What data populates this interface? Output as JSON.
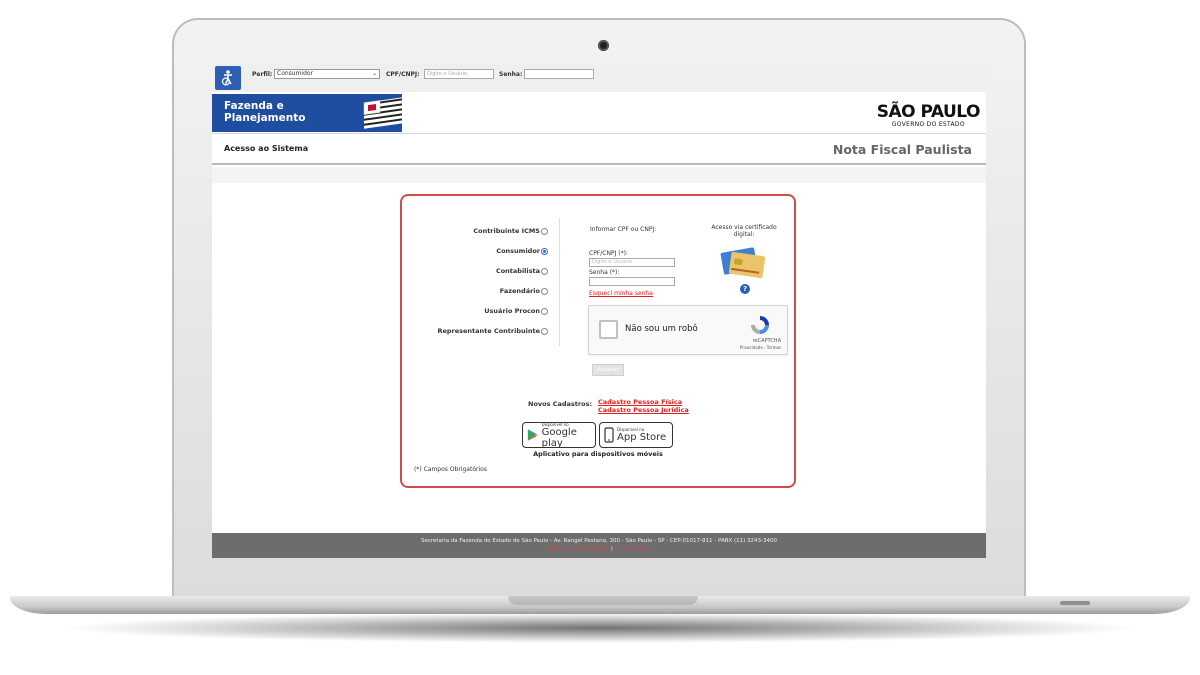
{
  "topbar": {
    "perfil_label": "Perfil:",
    "perfil_value": "Consumidor",
    "cpf_label": "CPF/CNPJ:",
    "cpf_placeholder": "Digite o Usuário",
    "senha_label": "Senha:",
    "senha_value": ""
  },
  "banner": {
    "brand_line1": "Fazenda e",
    "brand_line2": "Planejamento",
    "sp_logo_big": "SÃO PAULO",
    "sp_logo_small": "GOVERNO DO ESTADO"
  },
  "titlebar": {
    "left": "Acesso ao Sistema",
    "right": "Nota Fiscal Paulista"
  },
  "login": {
    "profiles": [
      {
        "label": "Contribuinte ICMS",
        "selected": false
      },
      {
        "label": "Consumidor",
        "selected": true
      },
      {
        "label": "Contabilista",
        "selected": false
      },
      {
        "label": "Fazendário",
        "selected": false
      },
      {
        "label": "Usuário Procon",
        "selected": false
      },
      {
        "label": "Representante Contribuinte",
        "selected": false
      }
    ],
    "cpf_hint": "Informar CPF ou CNPJ:",
    "cpf_field_label": "CPF/CNPJ (*):",
    "cpf_field_placeholder": "Digite o Usuário",
    "senha_field_label": "Senha (*):",
    "forgot_link": "Esqueci minha senha",
    "cert_text": "Acesso via certificado digital:",
    "captcha": {
      "text": "Não sou um robô",
      "brand": "reCAPTCHA",
      "terms": "Privacidade - Termos"
    },
    "submit_label": "Acessar",
    "novos_label": "Novos Cadastros:",
    "cadastro_fisica": "Cadastro Pessoa Física",
    "cadastro_juridica": "Cadastro Pessoa Jurídica",
    "google_play_small": "Disponível no",
    "google_play_name": "Google play",
    "app_store_small": "Disponível na",
    "app_store_name": "App Store",
    "app_caption": "Aplicativo para dispositivos móveis",
    "required_note": "(*) Campos Obrigatórios"
  },
  "footer": {
    "address": "Secretaria da Fazenda do Estado de São Paulo - Av. Rangel Pestana, 300 - São Paulo - SP - CEP:01017-911 - PABX (11) 3243-3400",
    "link1": "Política de Privacidade",
    "separator": "|",
    "link2": "Fale Conosco"
  },
  "colors": {
    "brand_blue": "#1f4ea0",
    "card_border": "#d24b4b",
    "link_red": "#dd2222",
    "footer_gray": "#6d6d6d"
  }
}
